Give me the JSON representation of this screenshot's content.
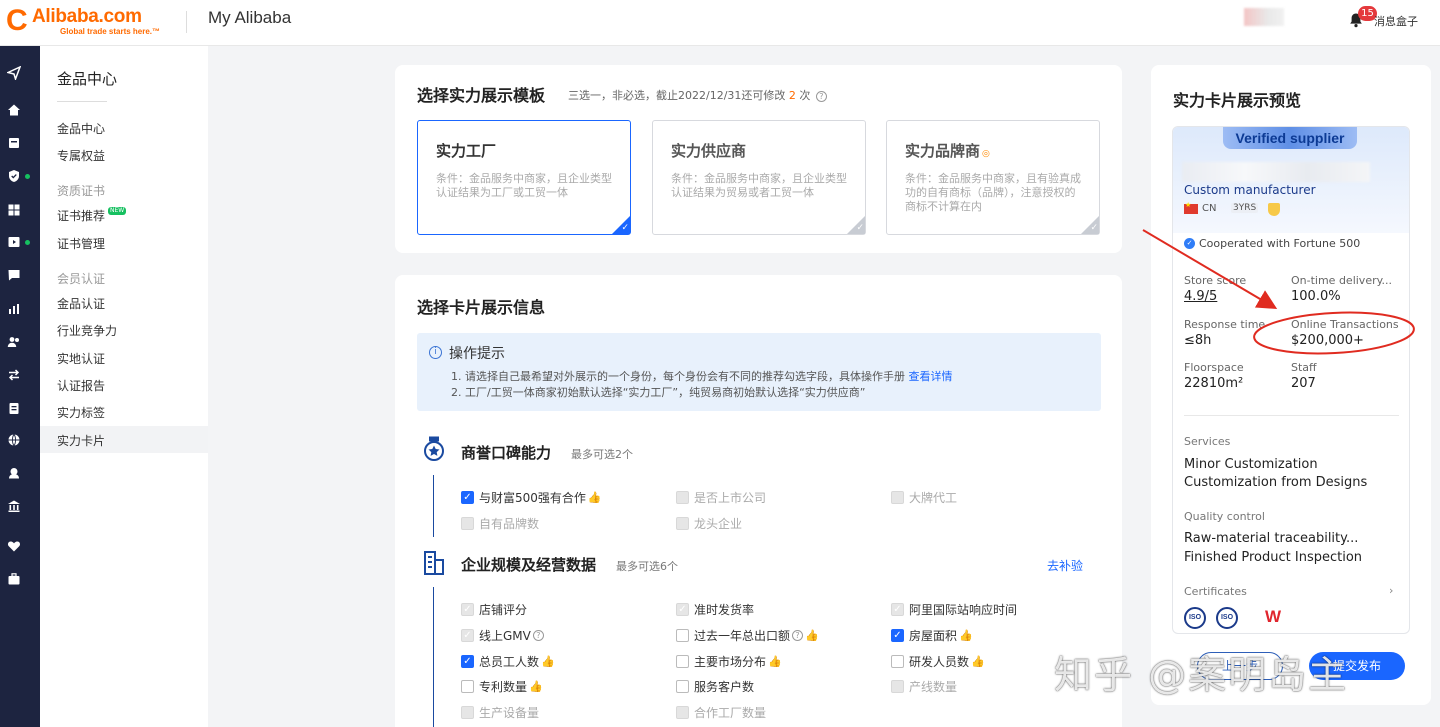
{
  "header": {
    "brand": "Alibaba.com",
    "tagline": "Global trade starts here.™",
    "app_title": "My Alibaba",
    "msg_count": "15",
    "msg_label": "消息盒子"
  },
  "sidebar": {
    "title": "金品中心",
    "items": [
      {
        "label": "金品中心",
        "type": "item"
      },
      {
        "label": "专属权益",
        "type": "item"
      },
      {
        "label": "资质证书",
        "type": "group"
      },
      {
        "label": "证书推荐",
        "type": "item",
        "tag": "NEW"
      },
      {
        "label": "证书管理",
        "type": "item"
      },
      {
        "label": "会员认证",
        "type": "group"
      },
      {
        "label": "金品认证",
        "type": "item"
      },
      {
        "label": "行业竞争力",
        "type": "item"
      },
      {
        "label": "实地认证",
        "type": "item"
      },
      {
        "label": "认证报告",
        "type": "item"
      },
      {
        "label": "实力标签",
        "type": "item"
      },
      {
        "label": "实力卡片",
        "type": "item",
        "active": true
      }
    ]
  },
  "template_section": {
    "title": "选择实力展示模板",
    "subtitle_pre": "三选一，非必选，截止2022/12/31还可修改",
    "subtitle_num": "2",
    "subtitle_post": "次",
    "options": [
      {
        "name": "实力工厂",
        "desc": "条件：金品服务中商家，且企业类型认证结果为工厂或工贸一体",
        "selected": true
      },
      {
        "name": "实力供应商",
        "desc": "条件：金品服务中商家，且企业类型认证结果为贸易或者工贸一体",
        "selected": false
      },
      {
        "name": "实力品牌商",
        "desc": "条件：金品服务中商家，且有验真成功的自有商标（品牌），注意授权的商标不计算在内",
        "selected": false
      }
    ]
  },
  "info_section": {
    "title": "选择卡片展示信息",
    "tips": {
      "heading": "操作提示",
      "line1": "1. 请选择自己最希望对外展示的一个身份，每个身份会有不同的推荐勾选字段，具体操作手册",
      "line1_link": "查看详情",
      "line2": "2. 工厂/工贸一体商家初始默认选择“实力工厂”，纯贸易商初始默认选择“实力供应商”"
    },
    "reputation": {
      "title": "商誉口碑能力",
      "limit": "最多可选2个",
      "options": [
        {
          "label": "与财富500强有合作",
          "state": "checked",
          "thumb": true
        },
        {
          "label": "是否上市公司",
          "state": "disabled"
        },
        {
          "label": "大牌代工",
          "state": "disabled"
        },
        {
          "label": "自有品牌数",
          "state": "disabled"
        },
        {
          "label": "龙头企业",
          "state": "disabled"
        }
      ]
    },
    "scale": {
      "title": "企业规模及经营数据",
      "limit": "最多可选6个",
      "action": "去补验",
      "options": [
        {
          "label": "店铺评分",
          "state": "disabled-checked"
        },
        {
          "label": "准时发货率",
          "state": "disabled-checked"
        },
        {
          "label": "阿里国际站响应时间",
          "state": "disabled-checked"
        },
        {
          "label": "线上GMV",
          "state": "disabled-checked",
          "help": true
        },
        {
          "label": "过去一年总出口额",
          "state": "unchecked",
          "help": true,
          "thumb": true
        },
        {
          "label": "房屋面积",
          "state": "checked",
          "thumb": true
        },
        {
          "label": "总员工人数",
          "state": "checked",
          "thumb": true
        },
        {
          "label": "主要市场分布",
          "state": "unchecked",
          "thumb": true
        },
        {
          "label": "研发人员数",
          "state": "unchecked",
          "thumb": true
        },
        {
          "label": "专利数量",
          "state": "unchecked",
          "thumb": true
        },
        {
          "label": "服务客户数",
          "state": "unchecked"
        },
        {
          "label": "产线数量",
          "state": "disabled"
        },
        {
          "label": "生产设备量",
          "state": "disabled"
        },
        {
          "label": "合作工厂数量",
          "state": "disabled"
        }
      ]
    }
  },
  "preview": {
    "title": "实力卡片展示预览",
    "badge": "Verified supplier",
    "company_type": "Custom manufacturer",
    "country": "CN",
    "years": "3YRS",
    "fortune": "Cooperated with Fortune 500",
    "stats": [
      {
        "label": "Store score",
        "value": "4.9/5"
      },
      {
        "label": "On-time delivery...",
        "value": "100.0%"
      },
      {
        "label": "Response time",
        "value": "≤8h"
      },
      {
        "label": "Online Transactions",
        "value": "$200,000+"
      },
      {
        "label": "Floorspace",
        "value": "22810m²"
      },
      {
        "label": "Staff",
        "value": "207"
      }
    ],
    "services_label": "Services",
    "services": [
      "Minor Customization",
      "Customization from Designs"
    ],
    "qc_label": "Quality control",
    "qc": [
      "Raw-material traceability...",
      "Finished Product Inspection"
    ],
    "certs_label": "Certificates",
    "certs": [
      "ISO",
      "ISO",
      "W"
    ],
    "btn_secondary": "上一步",
    "btn_primary": "提交发布"
  },
  "watermark": "知乎 @案明岛主",
  "colors": {
    "brand": "#ff6a00",
    "primary": "#1a66ff",
    "rail": "#1d2440",
    "annotation": "#e02b20"
  }
}
